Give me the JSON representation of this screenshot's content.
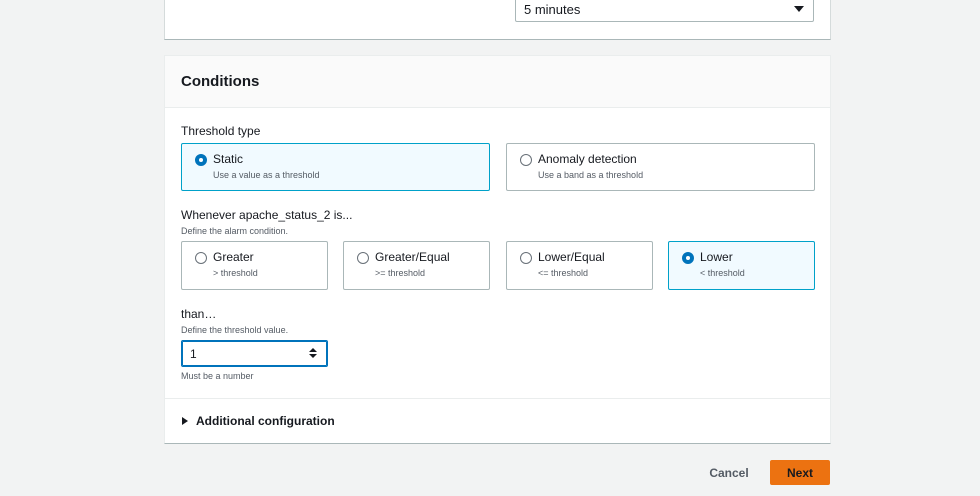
{
  "period": {
    "selected": "5 minutes"
  },
  "conditions": {
    "title": "Conditions",
    "threshold_type": {
      "label": "Threshold type",
      "options": [
        {
          "label": "Static",
          "description": "Use a value as a threshold",
          "selected": true
        },
        {
          "label": "Anomaly detection",
          "description": "Use a band as a threshold",
          "selected": false
        }
      ]
    },
    "whenever": {
      "label": "Whenever apache_status_2 is...",
      "description": "Define the alarm condition.",
      "options": [
        {
          "label": "Greater",
          "description": "> threshold",
          "selected": false
        },
        {
          "label": "Greater/Equal",
          "description": ">= threshold",
          "selected": false
        },
        {
          "label": "Lower/Equal",
          "description": "<= threshold",
          "selected": false
        },
        {
          "label": "Lower",
          "description": "< threshold",
          "selected": true
        }
      ]
    },
    "than": {
      "label": "than…",
      "description": "Define the threshold value.",
      "value": "1",
      "constraint": "Must be a number"
    },
    "additional_configuration": "Additional configuration"
  },
  "footer": {
    "cancel": "Cancel",
    "next": "Next"
  },
  "colors": {
    "accent": "#0073bb",
    "selected_border": "#00a1c9",
    "primary_button": "#ec7211"
  }
}
